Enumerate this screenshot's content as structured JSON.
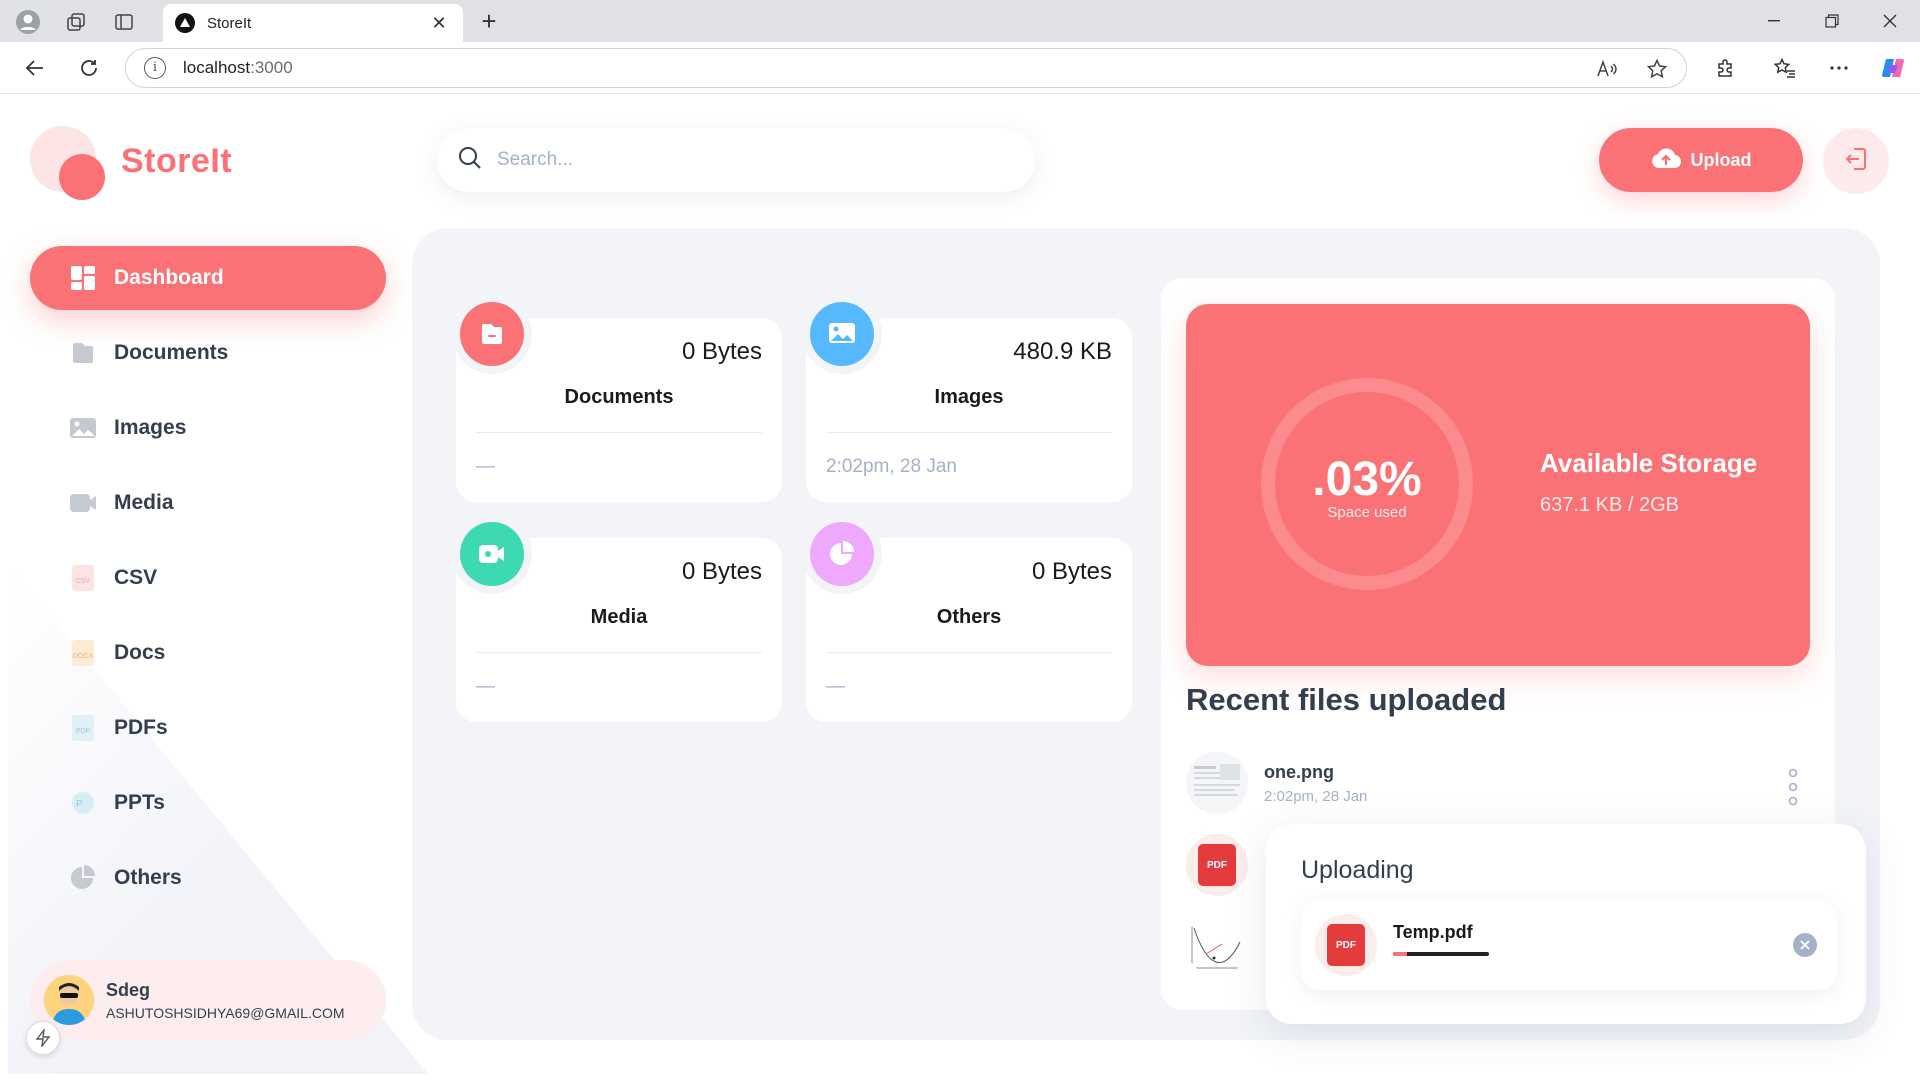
{
  "browser": {
    "tab_title": "StoreIt",
    "url_host": "localhost",
    "url_port": ":3000"
  },
  "app": {
    "logo_text": "StoreIt",
    "search_placeholder": "Search...",
    "upload_label": "Upload"
  },
  "sidebar": {
    "items": [
      {
        "label": "Dashboard",
        "icon": "dashboard-icon",
        "active": true
      },
      {
        "label": "Documents",
        "icon": "documents-icon"
      },
      {
        "label": "Images",
        "icon": "images-icon"
      },
      {
        "label": "Media",
        "icon": "media-icon"
      },
      {
        "label": "CSV",
        "icon": "csv-icon",
        "badge": "CSV"
      },
      {
        "label": "Docs",
        "icon": "docs-icon",
        "badge": "DOCX"
      },
      {
        "label": "PDFs",
        "icon": "pdf-icon",
        "badge": "PDF"
      },
      {
        "label": "PPTs",
        "icon": "ppt-icon"
      },
      {
        "label": "Others",
        "icon": "others-icon"
      }
    ]
  },
  "user": {
    "name": "Sdeg",
    "email": "ASHUTOSHSIDHYA69@GMAIL.COM"
  },
  "summary": [
    {
      "label": "Documents",
      "size": "0 Bytes",
      "date": "—",
      "color": "#FA7275",
      "icon": "documents-icon"
    },
    {
      "label": "Images",
      "size": "480.9 KB",
      "date": "2:02pm, 28 Jan",
      "color": "#56B8FF",
      "icon": "images-icon"
    },
    {
      "label": "Media",
      "size": "0 Bytes",
      "date": "—",
      "color": "#3DD9B3",
      "icon": "media-icon"
    },
    {
      "label": "Others",
      "size": "0 Bytes",
      "date": "—",
      "color": "#EEA8FD",
      "icon": "others-icon"
    }
  ],
  "storage": {
    "percent": ".03%",
    "percent_sub": "Space used",
    "title": "Available Storage",
    "value": "637.1 KB / 2GB"
  },
  "recent": {
    "title": "Recent files uploaded",
    "items": [
      {
        "name": "one.png",
        "date": "2:02pm, 28 Jan",
        "type": "image"
      },
      {
        "name": "",
        "date": "",
        "type": "pdf"
      },
      {
        "name": "",
        "date": "",
        "type": "chart-image"
      }
    ]
  },
  "uploading": {
    "title": "Uploading",
    "file": "Temp.pdf",
    "badge": "PDF",
    "progress": 0.15
  },
  "colors": {
    "brand": "#FA7275",
    "text": "#333F4E",
    "muted": "#A3B2C7",
    "bg": "#F2F4F8"
  }
}
